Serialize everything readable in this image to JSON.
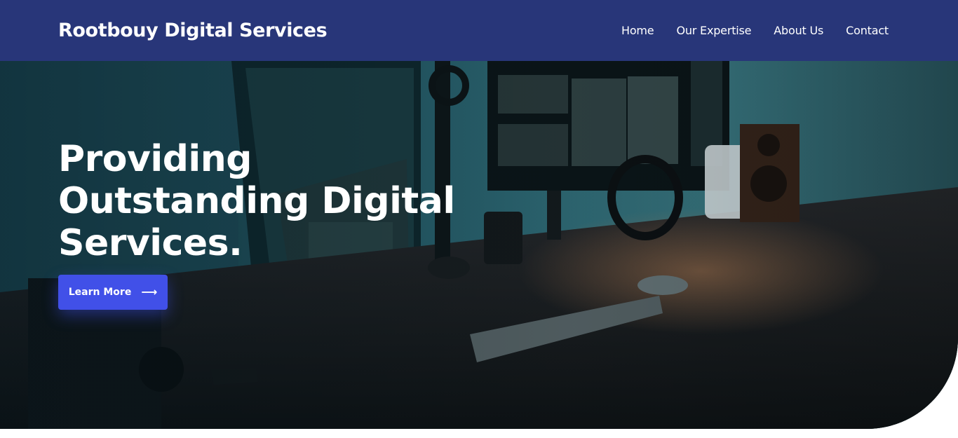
{
  "header": {
    "brand": "Rootbouy Digital Services",
    "nav": [
      {
        "label": "Home"
      },
      {
        "label": "Our Expertise"
      },
      {
        "label": "About Us"
      },
      {
        "label": "Contact"
      }
    ]
  },
  "hero": {
    "title_line1": "Providing",
    "title_line2": "Outstanding Digital",
    "title_line3": "Services.",
    "cta_label": "Learn More",
    "cta_icon": "arrow-right-icon"
  },
  "colors": {
    "header_bg": "#283679",
    "cta_bg": "#4150e8",
    "text": "#ffffff"
  }
}
